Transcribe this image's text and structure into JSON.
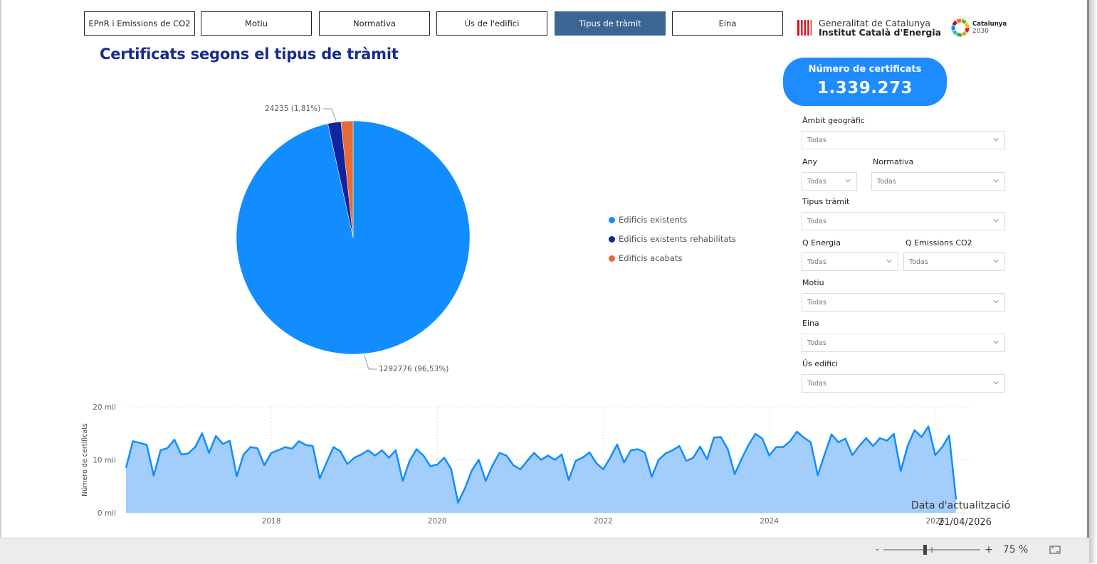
{
  "nav": {
    "tabs": [
      {
        "label": "EPnR i Emissions de CO2",
        "active": false
      },
      {
        "label": "Motiu",
        "active": false
      },
      {
        "label": "Normativa",
        "active": false
      },
      {
        "label": "Ús de l'edifici",
        "active": false
      },
      {
        "label": "Tipus de tràmit",
        "active": true
      },
      {
        "label": "Eina",
        "active": false
      }
    ]
  },
  "logos": {
    "generalitat_line1": "Generalitat de Catalunya",
    "generalitat_line2": "Institut Català d'Energia",
    "catalunya2030_line1": "Catalunya",
    "catalunya2030_line2": "2030"
  },
  "page_title": "Certificats segons el tipus de tràmit",
  "kpi": {
    "label": "Número de certificats",
    "value": "1.339.273"
  },
  "filters": {
    "ambit": {
      "label": "Àmbit geogràfic",
      "value": "Todas"
    },
    "any": {
      "label": "Any",
      "value": "Todas"
    },
    "normativa": {
      "label": "Normativa",
      "value": "Todas"
    },
    "tipus": {
      "label": "Tipus tràmit",
      "value": "Todas"
    },
    "q_energia": {
      "label": "Q Energia",
      "value": "Todas"
    },
    "q_emissions": {
      "label": "Q Emissions CO2",
      "value": "Todas"
    },
    "motiu": {
      "label": "Motiu",
      "value": "Todas"
    },
    "eina": {
      "label": "Eina",
      "value": "Todas"
    },
    "us": {
      "label": "Ús edifici",
      "value": "Todas"
    }
  },
  "update": {
    "label": "Data d'actualització",
    "date": "21/04/2026"
  },
  "zoom": {
    "minus": "-",
    "plus": "+",
    "value": "75 %"
  },
  "colors": {
    "blue": "#118dff",
    "navy": "#12239e",
    "orange": "#e66c37",
    "title": "#1a2a8c",
    "kpi_bg": "#1e8cff",
    "active_tab": "#3b6693"
  },
  "chart_data": [
    {
      "type": "pie",
      "categories": [
        "Edificis existents",
        "Edificis existents rehabilitats",
        "Edificis acabats"
      ],
      "values": [
        1292776,
        24235,
        22262
      ],
      "data_labels": [
        "1292776 (96,53%)",
        "24235 (1,81%)"
      ],
      "legend": "right"
    },
    {
      "type": "area",
      "ylabel": "Número de certificats",
      "y_ticks": [
        "0 mil",
        "10 mil",
        "20 mil"
      ],
      "x_ticks": [
        "2018",
        "2020",
        "2022",
        "2024",
        "2026"
      ],
      "ylim": [
        0,
        20000
      ],
      "x_start": "2016-04",
      "x_end": "2026-04",
      "values": [
        8500,
        13500,
        13200,
        12800,
        7000,
        11800,
        12200,
        13800,
        11000,
        11200,
        12400,
        15000,
        11300,
        14500,
        13000,
        13600,
        6900,
        11000,
        12400,
        12200,
        9000,
        11300,
        11800,
        12400,
        12100,
        13500,
        12800,
        12600,
        6500,
        9500,
        12400,
        11600,
        9200,
        10400,
        11000,
        11800,
        10800,
        11800,
        10400,
        11800,
        6000,
        9800,
        12000,
        10800,
        8800,
        9100,
        10400,
        8300,
        1900,
        4600,
        8000,
        10000,
        6000,
        9000,
        11300,
        10800,
        9000,
        8200,
        9800,
        11300,
        10000,
        10800,
        10000,
        11000,
        6200,
        9800,
        10400,
        11400,
        9400,
        8200,
        10400,
        12900,
        9500,
        11800,
        12000,
        11400,
        6800,
        10000,
        11200,
        11800,
        12600,
        9800,
        10400,
        12500,
        10100,
        14200,
        14300,
        12000,
        7300,
        10200,
        12800,
        14900,
        14000,
        10800,
        12400,
        12400,
        13500,
        15300,
        14200,
        13300,
        7100,
        11000,
        14800,
        13300,
        14000,
        10900,
        12600,
        14100,
        12600,
        14100,
        13600,
        14900,
        7900,
        12600,
        15600,
        14300,
        16300,
        10900,
        12400,
        14600,
        2500
      ]
    }
  ]
}
